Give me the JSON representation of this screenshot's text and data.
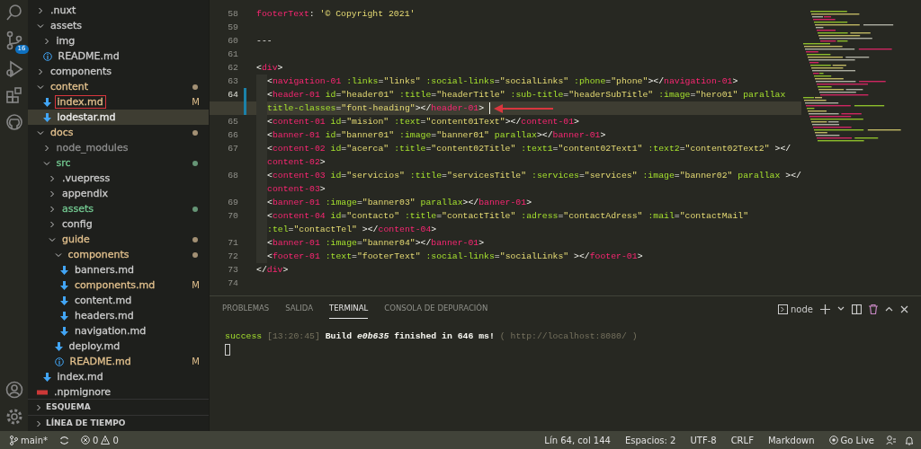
{
  "activity_bar": {
    "source_control_badge": "16"
  },
  "explorer": {
    "items": [
      {
        "label": ".nuxt",
        "kind": "folder",
        "expanded": false,
        "color": "#cccccc",
        "dot": false,
        "selected": false,
        "boxed": false
      },
      {
        "label": "assets",
        "kind": "folder",
        "expanded": true,
        "color": "#cccccc",
        "dot": false,
        "selected": false,
        "boxed": false,
        "children": [
          {
            "label": "img",
            "kind": "folder",
            "expanded": false,
            "color": "#cccccc",
            "dot": false,
            "selected": false,
            "boxed": false
          },
          {
            "label": "README.md",
            "kind": "info",
            "color": "#cccccc",
            "selected": false,
            "boxed": false
          }
        ]
      },
      {
        "label": "components",
        "kind": "folder",
        "expanded": false,
        "color": "#cccccc",
        "dot": false,
        "selected": false,
        "boxed": false
      },
      {
        "label": "content",
        "kind": "folder",
        "expanded": true,
        "color": "#e2c08d",
        "dot": true,
        "selected": false,
        "boxed": false,
        "children": [
          {
            "label": "index.md",
            "kind": "markdown",
            "color": "#e2c08d",
            "badge": "M",
            "selected": false,
            "boxed": true
          },
          {
            "label": "lodestar.md",
            "kind": "markdown",
            "selected": true,
            "boxed": false
          }
        ]
      },
      {
        "label": "docs",
        "kind": "folder",
        "expanded": true,
        "color": "#e2c08d",
        "dot": true,
        "selected": false,
        "boxed": false,
        "children": [
          {
            "label": "node_modules",
            "kind": "folder",
            "expanded": false,
            "color": "#8c8c8c",
            "dot": false,
            "selected": false,
            "boxed": false
          },
          {
            "label": "src",
            "kind": "folder",
            "expanded": true,
            "color": "#73c991",
            "dot": true,
            "selected": false,
            "boxed": false,
            "children": [
              {
                "label": ".vuepress",
                "kind": "folder",
                "expanded": false,
                "color": "#cccccc",
                "dot": false,
                "selected": false,
                "boxed": false
              },
              {
                "label": "appendix",
                "kind": "folder",
                "expanded": false,
                "color": "#cccccc",
                "dot": false,
                "selected": false,
                "boxed": false
              },
              {
                "label": "assets",
                "kind": "folder",
                "expanded": false,
                "color": "#73c991",
                "dot": true,
                "selected": false,
                "boxed": false
              },
              {
                "label": "config",
                "kind": "folder",
                "expanded": false,
                "color": "#cccccc",
                "dot": false,
                "selected": false,
                "boxed": false
              },
              {
                "label": "guide",
                "kind": "folder",
                "expanded": true,
                "color": "#e2c08d",
                "dot": true,
                "selected": false,
                "boxed": false,
                "children": [
                  {
                    "label": "components",
                    "kind": "folder",
                    "expanded": true,
                    "color": "#e2c08d",
                    "dot": true,
                    "selected": false,
                    "boxed": false,
                    "children": [
                      {
                        "label": "banners.md",
                        "kind": "markdown",
                        "color": "#cccccc",
                        "selected": false,
                        "boxed": false
                      },
                      {
                        "label": "components.md",
                        "kind": "markdown",
                        "color": "#e2c08d",
                        "badge": "M",
                        "selected": false,
                        "boxed": false
                      },
                      {
                        "label": "content.md",
                        "kind": "markdown",
                        "color": "#cccccc",
                        "selected": false,
                        "boxed": false
                      },
                      {
                        "label": "headers.md",
                        "kind": "markdown",
                        "color": "#cccccc",
                        "selected": false,
                        "boxed": false
                      },
                      {
                        "label": "navigation.md",
                        "kind": "markdown",
                        "color": "#cccccc",
                        "selected": false,
                        "boxed": false
                      }
                    ]
                  },
                  {
                    "label": "deploy.md",
                    "kind": "markdown",
                    "color": "#cccccc",
                    "selected": false,
                    "boxed": false
                  },
                  {
                    "label": "README.md",
                    "kind": "info",
                    "color": "#e2c08d",
                    "badge": "M",
                    "selected": false,
                    "boxed": false
                  }
                ]
              }
            ]
          },
          {
            "label": "index.md",
            "kind": "markdown",
            "color": "#cccccc",
            "selected": false,
            "boxed": false
          }
        ]
      },
      {
        "label": ".npmignore",
        "kind": "ignore",
        "color": "#cccccc",
        "selected": false,
        "boxed": false
      }
    ]
  },
  "sections": [
    {
      "label": "ESQUEMA",
      "expanded": false
    },
    {
      "label": "LÍNEA DE TIEMPO",
      "expanded": false
    }
  ],
  "editor": {
    "lines": [
      {
        "number": "58",
        "indent": false,
        "changed": false,
        "current": false,
        "arrow": false,
        "rows": [
          {
            "tokens": [
              {
                "kind": "key",
                "text": "footerText"
              },
              {
                "kind": "punct",
                "text": ": "
              },
              {
                "kind": "str",
                "text": "'© Copyright 2021'"
              }
            ]
          }
        ]
      },
      {
        "number": "59",
        "indent": false,
        "changed": false,
        "current": false,
        "arrow": false,
        "rows": [
          {
            "tokens": []
          }
        ]
      },
      {
        "number": "60",
        "indent": false,
        "changed": false,
        "current": false,
        "arrow": false,
        "rows": [
          {
            "tokens": [
              {
                "kind": "punct",
                "text": "---"
              }
            ]
          }
        ]
      },
      {
        "number": "61",
        "indent": false,
        "changed": false,
        "current": false,
        "arrow": false,
        "rows": [
          {
            "tokens": []
          }
        ]
      },
      {
        "number": "62",
        "indent": false,
        "changed": false,
        "current": false,
        "arrow": false,
        "rows": [
          {
            "tokens": [
              {
                "kind": "punct",
                "text": "<"
              },
              {
                "kind": "tag",
                "text": "div"
              },
              {
                "kind": "punct",
                "text": ">"
              }
            ]
          }
        ]
      },
      {
        "number": "63",
        "indent": true,
        "changed": false,
        "current": false,
        "arrow": false,
        "rows": [
          {
            "tokens": [
              {
                "kind": "punct",
                "text": "<"
              },
              {
                "kind": "tag",
                "text": "navigation-01"
              },
              {
                "kind": "attr",
                "text": " :links"
              },
              {
                "kind": "punct",
                "text": "="
              },
              {
                "kind": "str",
                "text": "\"links\""
              },
              {
                "kind": "attr",
                "text": " :social-links"
              },
              {
                "kind": "punct",
                "text": "="
              },
              {
                "kind": "str",
                "text": "\"socialLinks\""
              },
              {
                "kind": "attr",
                "text": " :phone"
              },
              {
                "kind": "punct",
                "text": "="
              },
              {
                "kind": "str",
                "text": "\"phone\""
              },
              {
                "kind": "punct",
                "text": "></"
              },
              {
                "kind": "tag",
                "text": "navigation-01"
              },
              {
                "kind": "punct",
                "text": ">"
              }
            ]
          }
        ]
      },
      {
        "number": "64",
        "indent": true,
        "changed": true,
        "current": true,
        "arrow": true,
        "rows": [
          {
            "tokens": [
              {
                "kind": "punct",
                "text": "<"
              },
              {
                "kind": "tag",
                "text": "header-01"
              },
              {
                "kind": "attr",
                "text": " id"
              },
              {
                "kind": "punct",
                "text": "="
              },
              {
                "kind": "str",
                "text": "\"header01\""
              },
              {
                "kind": "attr",
                "text": " :title"
              },
              {
                "kind": "punct",
                "text": "="
              },
              {
                "kind": "str",
                "text": "\"headerTitle\""
              },
              {
                "kind": "attr",
                "text": " :sub-title"
              },
              {
                "kind": "punct",
                "text": "="
              },
              {
                "kind": "str",
                "text": "\"headerSubTitle\""
              },
              {
                "kind": "attr",
                "text": " :image"
              },
              {
                "kind": "punct",
                "text": "="
              },
              {
                "kind": "str",
                "text": "\"hero01\""
              },
              {
                "kind": "attr",
                "text": " parallax"
              }
            ]
          },
          {
            "tokens": [
              {
                "kind": "attr",
                "text": "title-classes"
              },
              {
                "kind": "punct",
                "text": "="
              },
              {
                "kind": "str",
                "text": "\"font-heading\""
              },
              {
                "kind": "punct",
                "text": "></"
              },
              {
                "kind": "tag",
                "text": "header-01"
              },
              {
                "kind": "punct",
                "text": ">"
              }
            ]
          }
        ]
      },
      {
        "number": "65",
        "indent": true,
        "changed": false,
        "current": false,
        "arrow": false,
        "rows": [
          {
            "tokens": [
              {
                "kind": "punct",
                "text": "<"
              },
              {
                "kind": "tag",
                "text": "content-01"
              },
              {
                "kind": "attr",
                "text": " id"
              },
              {
                "kind": "punct",
                "text": "="
              },
              {
                "kind": "str",
                "text": "\"mision\""
              },
              {
                "kind": "attr",
                "text": " :text"
              },
              {
                "kind": "punct",
                "text": "="
              },
              {
                "kind": "str",
                "text": "\"content01Text\""
              },
              {
                "kind": "punct",
                "text": "></"
              },
              {
                "kind": "tag",
                "text": "content-01"
              },
              {
                "kind": "punct",
                "text": ">"
              }
            ]
          }
        ]
      },
      {
        "number": "66",
        "indent": true,
        "changed": false,
        "current": false,
        "arrow": false,
        "rows": [
          {
            "tokens": [
              {
                "kind": "punct",
                "text": "<"
              },
              {
                "kind": "tag",
                "text": "banner-01"
              },
              {
                "kind": "attr",
                "text": " id"
              },
              {
                "kind": "punct",
                "text": "="
              },
              {
                "kind": "str",
                "text": "\"banner01\""
              },
              {
                "kind": "attr",
                "text": " :image"
              },
              {
                "kind": "punct",
                "text": "="
              },
              {
                "kind": "str",
                "text": "\"banner01\""
              },
              {
                "kind": "attr",
                "text": " parallax"
              },
              {
                "kind": "punct",
                "text": "></"
              },
              {
                "kind": "tag",
                "text": "banner-01"
              },
              {
                "kind": "punct",
                "text": ">"
              }
            ]
          }
        ]
      },
      {
        "number": "67",
        "indent": true,
        "changed": false,
        "current": false,
        "arrow": false,
        "rows": [
          {
            "tokens": [
              {
                "kind": "punct",
                "text": "<"
              },
              {
                "kind": "tag",
                "text": "content-02"
              },
              {
                "kind": "attr",
                "text": " id"
              },
              {
                "kind": "punct",
                "text": "="
              },
              {
                "kind": "str",
                "text": "\"acerca\""
              },
              {
                "kind": "attr",
                "text": " :title"
              },
              {
                "kind": "punct",
                "text": "="
              },
              {
                "kind": "str",
                "text": "\"content02Title\""
              },
              {
                "kind": "attr",
                "text": " :text1"
              },
              {
                "kind": "punct",
                "text": "="
              },
              {
                "kind": "str",
                "text": "\"content02Text1\""
              },
              {
                "kind": "attr",
                "text": " :text2"
              },
              {
                "kind": "punct",
                "text": "="
              },
              {
                "kind": "str",
                "text": "\"content02Text2\""
              },
              {
                "kind": "punct",
                "text": " ></"
              }
            ]
          },
          {
            "tokens": [
              {
                "kind": "tag",
                "text": "content-02"
              },
              {
                "kind": "punct",
                "text": ">"
              }
            ]
          }
        ]
      },
      {
        "number": "68",
        "indent": true,
        "changed": false,
        "current": false,
        "arrow": false,
        "rows": [
          {
            "tokens": [
              {
                "kind": "punct",
                "text": "<"
              },
              {
                "kind": "tag",
                "text": "content-03"
              },
              {
                "kind": "attr",
                "text": " id"
              },
              {
                "kind": "punct",
                "text": "="
              },
              {
                "kind": "str",
                "text": "\"servicios\""
              },
              {
                "kind": "attr",
                "text": " :title"
              },
              {
                "kind": "punct",
                "text": "="
              },
              {
                "kind": "str",
                "text": "\"servicesTitle\""
              },
              {
                "kind": "attr",
                "text": " :services"
              },
              {
                "kind": "punct",
                "text": "="
              },
              {
                "kind": "str",
                "text": "\"services\""
              },
              {
                "kind": "attr",
                "text": " :image"
              },
              {
                "kind": "punct",
                "text": "="
              },
              {
                "kind": "str",
                "text": "\"banner02\""
              },
              {
                "kind": "attr",
                "text": " parallax"
              },
              {
                "kind": "punct",
                "text": " ></"
              }
            ]
          },
          {
            "tokens": [
              {
                "kind": "tag",
                "text": "content-03"
              },
              {
                "kind": "punct",
                "text": ">"
              }
            ]
          }
        ]
      },
      {
        "number": "69",
        "indent": true,
        "changed": false,
        "current": false,
        "arrow": false,
        "rows": [
          {
            "tokens": [
              {
                "kind": "punct",
                "text": "<"
              },
              {
                "kind": "tag",
                "text": "banner-01"
              },
              {
                "kind": "attr",
                "text": " :image"
              },
              {
                "kind": "punct",
                "text": "="
              },
              {
                "kind": "str",
                "text": "\"banner03\""
              },
              {
                "kind": "attr",
                "text": " parallax"
              },
              {
                "kind": "punct",
                "text": "></"
              },
              {
                "kind": "tag",
                "text": "banner-01"
              },
              {
                "kind": "punct",
                "text": ">"
              }
            ]
          }
        ]
      },
      {
        "number": "70",
        "indent": true,
        "changed": false,
        "current": false,
        "arrow": false,
        "rows": [
          {
            "tokens": [
              {
                "kind": "punct",
                "text": "<"
              },
              {
                "kind": "tag",
                "text": "content-04"
              },
              {
                "kind": "attr",
                "text": " id"
              },
              {
                "kind": "punct",
                "text": "="
              },
              {
                "kind": "str",
                "text": "\"contacto\""
              },
              {
                "kind": "attr",
                "text": " :title"
              },
              {
                "kind": "punct",
                "text": "="
              },
              {
                "kind": "str",
                "text": "\"contactTitle\""
              },
              {
                "kind": "attr",
                "text": " :adress"
              },
              {
                "kind": "punct",
                "text": "="
              },
              {
                "kind": "str",
                "text": "\"contactAdress\""
              },
              {
                "kind": "attr",
                "text": " :mail"
              },
              {
                "kind": "punct",
                "text": "="
              },
              {
                "kind": "str",
                "text": "\"contactMail\""
              }
            ]
          },
          {
            "tokens": [
              {
                "kind": "attr",
                "text": ":tel"
              },
              {
                "kind": "punct",
                "text": "="
              },
              {
                "kind": "str",
                "text": "\"contactTel\""
              },
              {
                "kind": "punct",
                "text": " ></"
              },
              {
                "kind": "tag",
                "text": "content-04"
              },
              {
                "kind": "punct",
                "text": ">"
              }
            ]
          }
        ]
      },
      {
        "number": "71",
        "indent": true,
        "changed": false,
        "current": false,
        "arrow": false,
        "rows": [
          {
            "tokens": [
              {
                "kind": "punct",
                "text": "<"
              },
              {
                "kind": "tag",
                "text": "banner-01"
              },
              {
                "kind": "attr",
                "text": " :image"
              },
              {
                "kind": "punct",
                "text": "="
              },
              {
                "kind": "str",
                "text": "\"banner04\""
              },
              {
                "kind": "punct",
                "text": "></"
              },
              {
                "kind": "tag",
                "text": "banner-01"
              },
              {
                "kind": "punct",
                "text": ">"
              }
            ]
          }
        ]
      },
      {
        "number": "72",
        "indent": true,
        "changed": false,
        "current": false,
        "arrow": false,
        "rows": [
          {
            "tokens": [
              {
                "kind": "punct",
                "text": "<"
              },
              {
                "kind": "tag",
                "text": "footer-01"
              },
              {
                "kind": "attr",
                "text": " :text"
              },
              {
                "kind": "punct",
                "text": "="
              },
              {
                "kind": "str",
                "text": "\"footerText\""
              },
              {
                "kind": "attr",
                "text": " :social-links"
              },
              {
                "kind": "punct",
                "text": "="
              },
              {
                "kind": "str",
                "text": "\"socialLinks\""
              },
              {
                "kind": "punct",
                "text": " ></"
              },
              {
                "kind": "tag",
                "text": "footer-01"
              },
              {
                "kind": "punct",
                "text": ">"
              }
            ]
          }
        ]
      },
      {
        "number": "73",
        "indent": false,
        "changed": false,
        "current": false,
        "arrow": false,
        "rows": [
          {
            "tokens": [
              {
                "kind": "punct",
                "text": "</"
              },
              {
                "kind": "tag",
                "text": "div"
              },
              {
                "kind": "punct",
                "text": ">"
              }
            ]
          }
        ]
      },
      {
        "number": "74",
        "indent": false,
        "changed": false,
        "current": false,
        "arrow": false,
        "rows": [
          {
            "tokens": []
          }
        ]
      }
    ]
  },
  "panel": {
    "tabs": [
      {
        "label": "PROBLEMAS",
        "selected": false
      },
      {
        "label": "SALIDA",
        "selected": false
      },
      {
        "label": "TERMINAL",
        "selected": true
      },
      {
        "label": "CONSOLA DE DEPURACIÓN",
        "selected": false
      }
    ],
    "terminal_name": "node",
    "output": [
      {
        "kind": "success",
        "text": "success"
      },
      {
        "kind": "dim",
        "text": " [13:20:45]"
      },
      {
        "kind": "bold",
        "text": " Build "
      },
      {
        "kind": "bolditalic",
        "text": "e0b635"
      },
      {
        "kind": "bold",
        "text": " finished in 646 ms!"
      },
      {
        "kind": "dim",
        "text": " ( http://localhost:8080/ )"
      }
    ]
  },
  "status_bar": {
    "branch": "main*",
    "errors": "0",
    "warnings": "0",
    "right": [
      "Lín 64, col 144",
      "Espacios: 2",
      "UTF-8",
      "CRLF",
      "Markdown"
    ],
    "go_live": "Go Live"
  }
}
